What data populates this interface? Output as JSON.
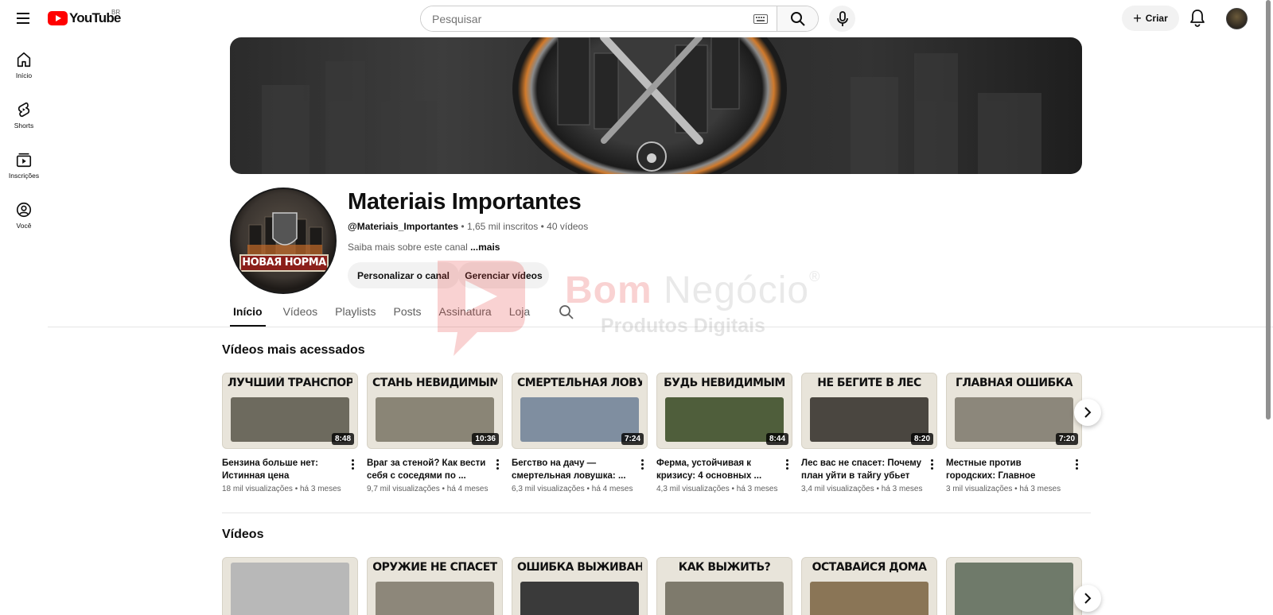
{
  "header": {
    "logo_text": "YouTube",
    "country": "BR",
    "search_placeholder": "Pesquisar",
    "create_label": "Criar"
  },
  "sidenav": {
    "items": [
      {
        "label": "Início",
        "icon": "home-icon"
      },
      {
        "label": "Shorts",
        "icon": "shorts-icon"
      },
      {
        "label": "Inscrições",
        "icon": "subscriptions-icon"
      },
      {
        "label": "Você",
        "icon": "you-icon"
      }
    ]
  },
  "channel": {
    "name": "Materiais Importantes",
    "handle": "@Materiais_Importantes",
    "stats": " • 1,65 mil inscritos • 40 vídeos",
    "about": "Saiba mais sobre este canal ",
    "about_more": "...mais",
    "btn_customize": "Personalizar o canal",
    "btn_manage": "Gerenciar vídeos",
    "avatar_text": "НОВАЯ НОРМА"
  },
  "tabs": [
    "Início",
    "Vídeos",
    "Playlists",
    "Posts",
    "Assinatura",
    "Loja"
  ],
  "sections": {
    "popular_title": "Vídeos mais acessados",
    "videos_title": "Vídeos"
  },
  "popular_videos": [
    {
      "thumb_text": "ЛУЧШИЙ ТРАНСПОРТ",
      "duration": "8:48",
      "title": "Бензина больше нет: Истинная цена велосипед...",
      "meta": "18 mil visualizações • há 3 meses",
      "art_color": "#6d6a5e"
    },
    {
      "thumb_text": "СТАНЬ НЕВИДИМЫМ",
      "duration": "10:36",
      "title": "Враг за стеной? Как вести себя с соседями по ...",
      "meta": "9,7 mil visualizações • há 4 meses",
      "art_color": "#8a8576"
    },
    {
      "thumb_text": "СМЕРТЕЛЬНАЯ ЛОВУШКА",
      "duration": "7:24",
      "title": "Бегство на дачу — смертельная ловушка: ...",
      "meta": "6,3 mil visualizações • há 4 meses",
      "art_color": "#7f8ea0"
    },
    {
      "thumb_text": "БУДЬ НЕВИДИМЫМ",
      "duration": "8:44",
      "title": "Ферма, устойчивая к кризису: 4 основных ...",
      "meta": "4,3 mil visualizações • há 3 meses",
      "art_color": "#4f5e3b"
    },
    {
      "thumb_text": "НЕ БЕГИТЕ В ЛЕС",
      "duration": "8:20",
      "title": "Лес вас не спасет: Почему план уйти в тайгу убьет ва...",
      "meta": "3,4 mil visualizações • há 3 meses",
      "art_color": "#4a4640"
    },
    {
      "thumb_text": "ГЛАВНАЯ ОШИБКА",
      "duration": "7:20",
      "title": "Местные против городских: Главное правило ...",
      "meta": "3 mil visualizações • há 3 meses",
      "art_color": "#8c877b"
    }
  ],
  "videos": [
    {
      "thumb_text": "",
      "art_color": "#b8b8b8"
    },
    {
      "thumb_text": "ОРУЖИЕ НЕ СПАСЕТ",
      "art_color": "#8d877a"
    },
    {
      "thumb_text": "ОШИБКА ВЫЖИВАНИЯ",
      "art_color": "#3a3a3a"
    },
    {
      "thumb_text": "КАК ВЫЖИТЬ?",
      "art_color": "#7e7a6c"
    },
    {
      "thumb_text": "ОСТАВАЙСЯ ДОМА",
      "art_color": "#8a7556"
    },
    {
      "thumb_text": "",
      "art_color": "#6f7a6a"
    }
  ],
  "watermark": {
    "brand_bold": "Bom",
    "brand_light": "Negócio",
    "reg": "®",
    "sub": "Produtos Digitais"
  }
}
